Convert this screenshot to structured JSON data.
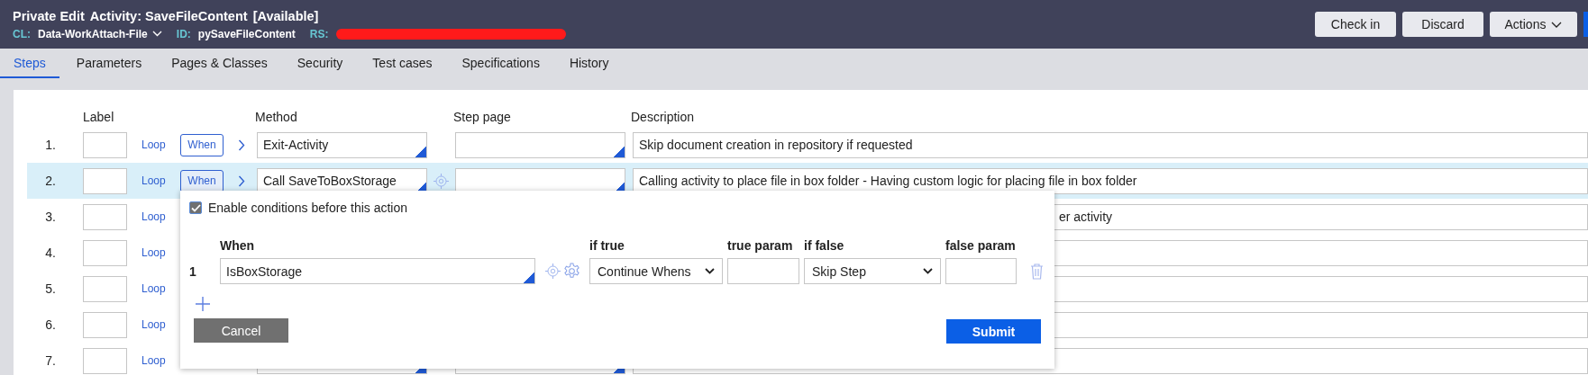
{
  "header": {
    "lock_label": "Private Edit",
    "title": "Activity: SaveFileContent",
    "status": "[Available]",
    "class_label": "CL:",
    "class_value": "Data-WorkAttach-File",
    "id_label": "ID:",
    "id_value": "pySaveFileContent",
    "rs_label": "RS:",
    "buttons": [
      "Check in",
      "Discard",
      "Actions"
    ]
  },
  "tabs": [
    {
      "label": "Steps",
      "selected": true
    },
    {
      "label": "Parameters",
      "selected": false
    },
    {
      "label": "Pages & Classes",
      "selected": false
    },
    {
      "label": "Security",
      "selected": false
    },
    {
      "label": "Test cases",
      "selected": false
    },
    {
      "label": "Specifications",
      "selected": false
    },
    {
      "label": "History",
      "selected": false
    }
  ],
  "steps": {
    "columns": [
      "Label",
      "Method",
      "Step page",
      "Description"
    ],
    "rows": [
      {
        "number": "1.",
        "loop": "Loop",
        "when": "When",
        "method": "Exit-Activity",
        "description": "Skip document creation in repository if requested",
        "selected": false
      },
      {
        "number": "2.",
        "loop": "Loop",
        "when": "When",
        "method": "Call SaveToBoxStorage",
        "description": "Calling activity to place file in box folder - Having custom logic for placing file in box folder",
        "selected": true
      },
      {
        "number": "3.",
        "loop": "Loop",
        "description": "er activity",
        "selected": false
      },
      {
        "number": "4.",
        "loop": "Loop",
        "selected": false
      },
      {
        "number": "5.",
        "loop": "Loop",
        "selected": false
      },
      {
        "number": "6.",
        "loop": "Loop",
        "selected": false
      },
      {
        "number": "7.",
        "loop": "Loop",
        "selected": false
      }
    ]
  },
  "when_dialog": {
    "enable_label": "Enable conditions before this action",
    "checked": true,
    "columns": [
      "When",
      "if true",
      "true param",
      "if false",
      "false param"
    ],
    "conditions": [
      {
        "number": "1",
        "when": "IsBoxStorage",
        "if_true": "Continue Whens",
        "if_false": "Skip Step"
      }
    ],
    "buttons": [
      "Cancel",
      "Submit"
    ]
  }
}
